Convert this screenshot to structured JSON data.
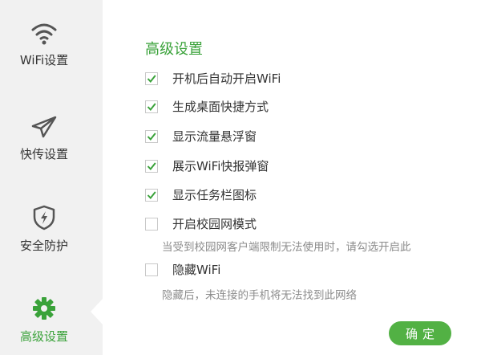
{
  "sidebar": {
    "items": [
      {
        "label": "WiFi设置",
        "icon": "wifi-icon"
      },
      {
        "label": "快传设置",
        "icon": "paper-plane-icon"
      },
      {
        "label": "安全防护",
        "icon": "shield-bolt-icon"
      },
      {
        "label": "高级设置",
        "icon": "gear-icon",
        "active": true
      }
    ]
  },
  "main": {
    "title": "高级设置",
    "options": [
      {
        "label": "开机后自动开启WiFi",
        "checked": true
      },
      {
        "label": "生成桌面快捷方式",
        "checked": true
      },
      {
        "label": "显示流量悬浮窗",
        "checked": true
      },
      {
        "label": "展示WiFi快报弹窗",
        "checked": true
      },
      {
        "label": "显示任务栏图标",
        "checked": true
      },
      {
        "label": "开启校园网模式",
        "checked": false,
        "description": "当受到校园网客户端限制无法使用时，请勾选开启此"
      },
      {
        "label": "隐藏WiFi",
        "checked": false,
        "description": "隐藏后，未连接的手机将无法找到此网络"
      }
    ],
    "ok_label": "确定"
  },
  "colors": {
    "accent": "#3aa23a",
    "button": "#52b144",
    "sidebar_bg": "#f1f1f1"
  }
}
